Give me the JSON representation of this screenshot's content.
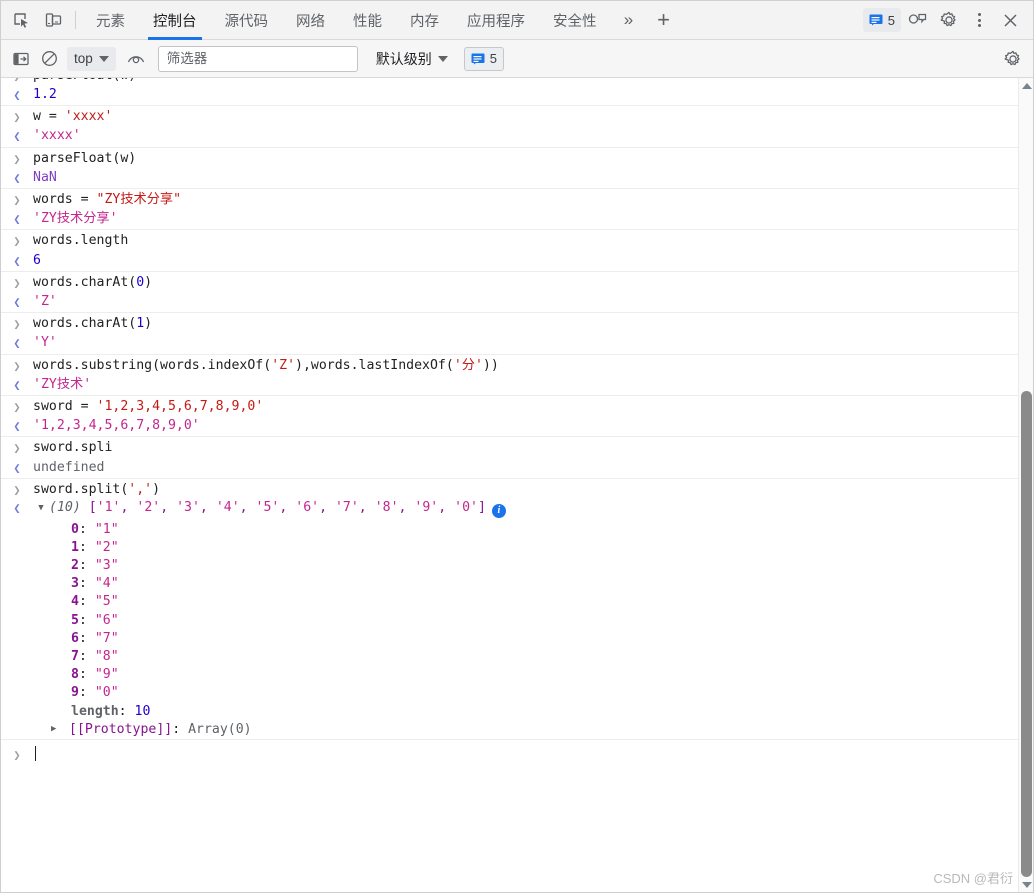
{
  "tabbar": {
    "icons": [
      {
        "name": "inspect-element-icon",
        "title": "检查"
      },
      {
        "name": "device-toolbar-icon",
        "title": "设备工具栏"
      }
    ],
    "tabs": [
      {
        "label": "元素",
        "active": false
      },
      {
        "label": "控制台",
        "active": true
      },
      {
        "label": "源代码",
        "active": false
      },
      {
        "label": "网络",
        "active": false
      },
      {
        "label": "性能",
        "active": false
      },
      {
        "label": "内存",
        "active": false
      },
      {
        "label": "应用程序",
        "active": false
      },
      {
        "label": "安全性",
        "active": false
      }
    ],
    "more_label": "»",
    "plus_label": "+",
    "message_count": "5",
    "close_label": "✕",
    "accent_color": "#1a73e8"
  },
  "console_toolbar": {
    "clear_console_title": "清除控制台",
    "sidebar_toggle_title": "显示控制台侧边栏",
    "context_value": "top",
    "eye_title": "实时表达式",
    "filter": {
      "value": "",
      "placeholder": "筛选器"
    },
    "level_label": "默认级别",
    "message_count": "5",
    "settings_title": "控制台设置"
  },
  "console": {
    "clipped_top_line": "parseFloat(w)",
    "entries": [
      {
        "type": "group",
        "command": [
          {
            "t": "plain",
            "v": "parseFloat(w)"
          }
        ],
        "command_clipped": true,
        "result": [
          {
            "t": "resnum",
            "v": "1.2"
          }
        ]
      },
      {
        "type": "group",
        "command": [
          {
            "t": "plain",
            "v": "w = "
          },
          {
            "t": "str",
            "v": "'xxxx'"
          }
        ],
        "result": [
          {
            "t": "resstr",
            "v": "'xxxx'"
          }
        ]
      },
      {
        "type": "group",
        "command": [
          {
            "t": "plain",
            "v": "parseFloat(w)"
          }
        ],
        "result": [
          {
            "t": "kw",
            "v": "NaN"
          }
        ]
      },
      {
        "type": "group",
        "command": [
          {
            "t": "plain",
            "v": "words = "
          },
          {
            "t": "str",
            "v": "\"ZY技术分享\""
          }
        ],
        "result": [
          {
            "t": "resstr",
            "v": "'ZY技术分享'"
          }
        ]
      },
      {
        "type": "group",
        "command": [
          {
            "t": "plain",
            "v": "words.length"
          }
        ],
        "result": [
          {
            "t": "resnum",
            "v": "6"
          }
        ]
      },
      {
        "type": "group",
        "command": [
          {
            "t": "plain",
            "v": "words.charAt("
          },
          {
            "t": "num",
            "v": "0"
          },
          {
            "t": "plain",
            "v": ")"
          }
        ],
        "result": [
          {
            "t": "resstr",
            "v": "'Z'"
          }
        ]
      },
      {
        "type": "group",
        "command": [
          {
            "t": "plain",
            "v": "words.charAt("
          },
          {
            "t": "num",
            "v": "1"
          },
          {
            "t": "plain",
            "v": ")"
          }
        ],
        "result": [
          {
            "t": "resstr",
            "v": "'Y'"
          }
        ]
      },
      {
        "type": "group",
        "command": [
          {
            "t": "plain",
            "v": "words.substring(words.indexOf("
          },
          {
            "t": "str",
            "v": "'Z'"
          },
          {
            "t": "plain",
            "v": "),words.lastIndexOf("
          },
          {
            "t": "str",
            "v": "'分'"
          },
          {
            "t": "plain",
            "v": "))"
          }
        ],
        "result": [
          {
            "t": "resstr",
            "v": "'ZY技术'"
          }
        ]
      },
      {
        "type": "group",
        "command": [
          {
            "t": "plain",
            "v": "sword = "
          },
          {
            "t": "str",
            "v": "'1,2,3,4,5,6,7,8,9,0'"
          }
        ],
        "result": [
          {
            "t": "resstr",
            "v": "'1,2,3,4,5,6,7,8,9,0'"
          }
        ]
      },
      {
        "type": "group",
        "command": [
          {
            "t": "plain",
            "v": "sword.spli"
          }
        ],
        "result": [
          {
            "t": "undef",
            "v": "undefined"
          }
        ]
      }
    ],
    "array_entry": {
      "command": [
        {
          "t": "plain",
          "v": "sword.split("
        },
        {
          "t": "str",
          "v": "','"
        },
        {
          "t": "plain",
          "v": ")"
        }
      ],
      "expander": "▼",
      "count_label": "(10)",
      "preview_open": "[",
      "preview_items": [
        "'1'",
        "'2'",
        "'3'",
        "'4'",
        "'5'",
        "'6'",
        "'7'",
        "'8'",
        "'9'",
        "'0'"
      ],
      "preview_close": "]",
      "info_icon": "i",
      "properties": [
        {
          "key": "0",
          "value": "\"1\""
        },
        {
          "key": "1",
          "value": "\"2\""
        },
        {
          "key": "2",
          "value": "\"3\""
        },
        {
          "key": "3",
          "value": "\"4\""
        },
        {
          "key": "4",
          "value": "\"5\""
        },
        {
          "key": "5",
          "value": "\"6\""
        },
        {
          "key": "6",
          "value": "\"7\""
        },
        {
          "key": "7",
          "value": "\"8\""
        },
        {
          "key": "8",
          "value": "\"9\""
        },
        {
          "key": "9",
          "value": "\"0\""
        }
      ],
      "length_key": "length",
      "length_value": "10",
      "proto_expander": "▶",
      "proto_key": "[[Prototype]]",
      "proto_value": "Array(0)"
    },
    "input_prompt": "",
    "gutter_in": "❯",
    "gutter_out": "❮"
  },
  "scrollbar": {
    "up_arrow": "▲",
    "down_arrow": "▼",
    "thumb_top_pct": 38,
    "thumb_height_pct": 62
  },
  "watermark": "CSDN @君衍"
}
